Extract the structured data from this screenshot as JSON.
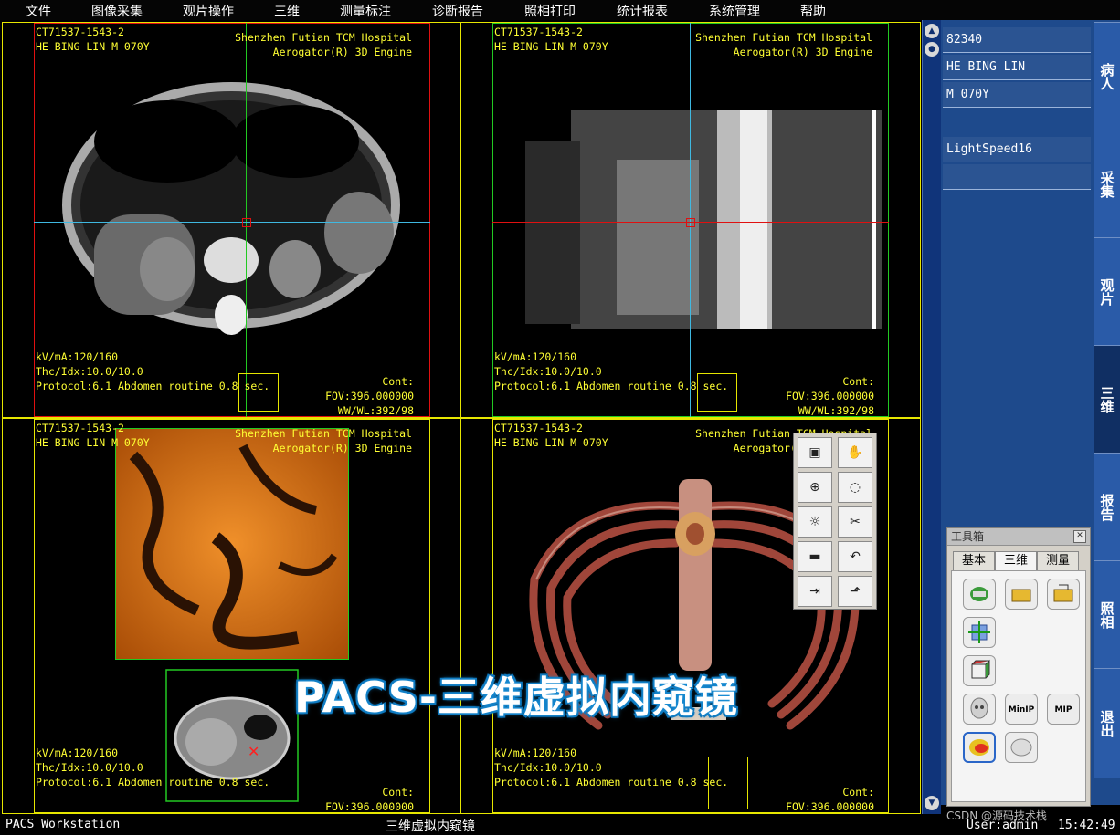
{
  "menu": [
    "文件",
    "图像采集",
    "观片操作",
    "三维",
    "测量标注",
    "诊断报告",
    "照相打印",
    "统计报表",
    "系统管理",
    "帮助"
  ],
  "viewports": [
    {
      "id": "axial",
      "study": "CT71537-1543-2",
      "patient": "HE BING LIN M 070Y",
      "hospital": "Shenzhen Futian TCM Hospital",
      "engine": "Aerogator(R) 3D Engine",
      "kv": "kV/mA:120/160",
      "thc": "Thc/Idx:10.0/10.0",
      "protocol": "Protocol:6.1 Abdomen routine 0.8 sec.",
      "cont": "Cont:",
      "fov": "FOV:396.000000",
      "wwwl": "WW/WL:392/98"
    },
    {
      "id": "sagittal",
      "study": "CT71537-1543-2",
      "patient": "HE BING LIN M 070Y",
      "hospital": "Shenzhen Futian TCM Hospital",
      "engine": "Aerogator(R) 3D Engine",
      "kv": "kV/mA:120/160",
      "thc": "Thc/Idx:10.0/10.0",
      "protocol": "Protocol:6.1 Abdomen routine 0.8 sec.",
      "cont": "Cont:",
      "fov": "FOV:396.000000",
      "wwwl": "WW/WL:392/98"
    },
    {
      "id": "endoscopy",
      "study": "CT71537-1543-2",
      "patient": "HE BING LIN M 070Y",
      "hospital": "Shenzhen Futian TCM Hospital",
      "engine": "Aerogator(R) 3D Engine",
      "kv": "kV/mA:120/160",
      "thc": "Thc/Idx:10.0/10.0",
      "protocol": "Protocol:6.1 Abdomen routine 0.8 sec.",
      "cont": "Cont:",
      "fov": "FOV:396.000000"
    },
    {
      "id": "volume",
      "study": "CT71537-1543-2",
      "patient": "HE BING LIN M 070Y",
      "hospital": "Shenzhen Futian TCM Hospital",
      "engine": "Aerogator(R) 3D Engine",
      "kv": "kV/mA:120/160",
      "thc": "Thc/Idx:10.0/10.0",
      "protocol": "Protocol:6.1 Abdomen routine 0.8 sec.",
      "cont": "Cont:",
      "fov": "FOV:396.000000"
    }
  ],
  "patient_panel": {
    "id": "82340",
    "name": "HE BING LIN",
    "sex_age": "M 070Y",
    "scanner": "LightSpeed16"
  },
  "side_tabs": [
    "病人",
    "采集",
    "观片",
    "三维",
    "报告",
    "照相",
    "退出"
  ],
  "active_side_tab": "三维",
  "toolbox": {
    "title": "工具箱",
    "close": "✕",
    "tabs": [
      "基本",
      "三维",
      "测量"
    ],
    "selected_tab": "三维",
    "minip": "MinIP",
    "mip": "MIP"
  },
  "palette_icons": [
    "volume-box-icon",
    "hand-pan-icon",
    "zoom-icon",
    "lasso-icon",
    "sun-brightness-icon",
    "scissors-icon",
    "ruler-icon",
    "undo-icon",
    "split-view-icon",
    "export-icon"
  ],
  "status": {
    "left": "PACS Workstation",
    "center": "三维虚拟内窥镜",
    "user": "User:admin",
    "time": "15:42:49",
    "credit": "CSDN @源码技术栈"
  },
  "watermark": "PACS-三维虚拟内窥镜",
  "colors": {
    "overlay_text": "#ffff33",
    "active_frame": "#e01010",
    "frame": "#e6e600",
    "crosshair_v": "#22c922",
    "crosshair_h": "#3fb8e0",
    "panel_blue": "#1e4a8c"
  }
}
